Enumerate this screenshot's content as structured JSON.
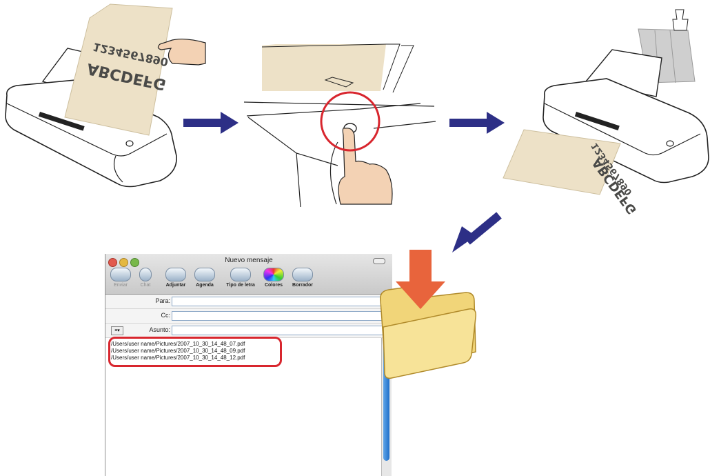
{
  "paper_text": {
    "digits": "1234567890",
    "letters": "ABCDEFG"
  },
  "mail_window": {
    "title": "Nuevo mensaje",
    "toolbar": [
      "Enviar",
      "Chat",
      "Adjuntar",
      "Agenda",
      "Tipo de letra",
      "Colores",
      "Borrador"
    ],
    "fields": {
      "to_label": "Para:",
      "cc_label": "Cc:",
      "subject_label": "Asunto:"
    },
    "attachments": [
      "/Users/user name/Pictures/2007_10_30_14_48_07.pdf",
      "/Users/user name/Pictures/2007_10_30_14_48_09.pdf",
      "/Users/user name/Pictures/2007_10_30_14_48_12.pdf"
    ]
  },
  "colors": {
    "arrow": "#2d2f86",
    "highlight": "#d8262e",
    "paper": "#ede1c7",
    "folder": "#f4dc86",
    "drop_arrow": "#e8643c"
  },
  "icons": [
    "hand-icon",
    "finger-press-icon",
    "folder-icon",
    "down-arrow-icon"
  ]
}
